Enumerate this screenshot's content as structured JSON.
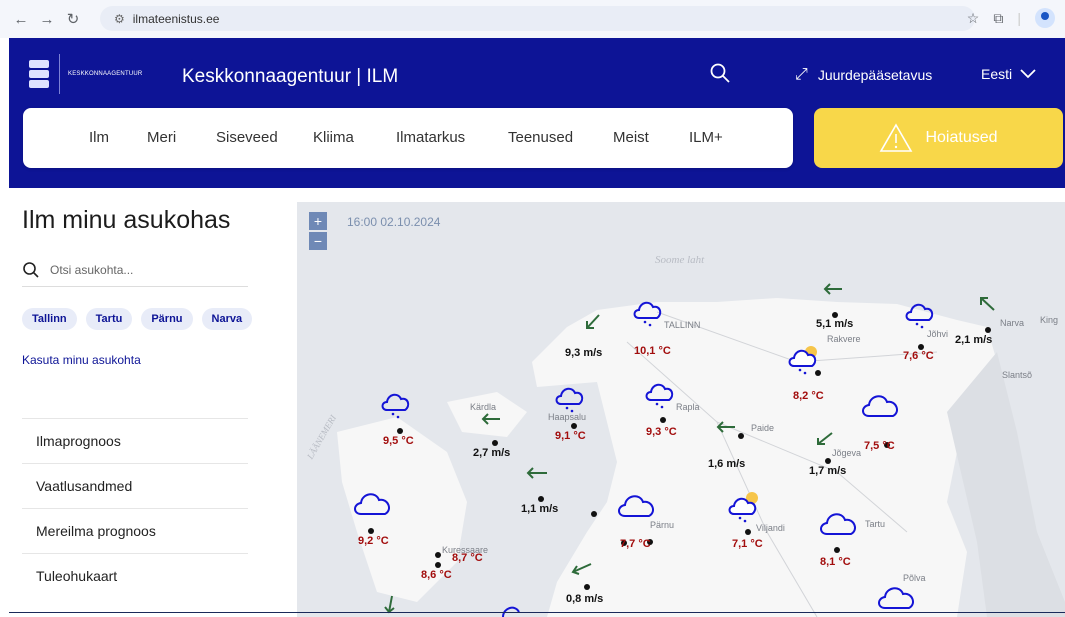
{
  "browser": {
    "url": "ilmateenistus.ee"
  },
  "header": {
    "logo_text": "KESKKONNAAGENTUUR",
    "title": "Keskkonnaagentuur | ILM",
    "access_label": "Juurdepääsetavus",
    "lang_label": "Eesti"
  },
  "menu": [
    "Ilm",
    "Meri",
    "Siseveed",
    "Kliima",
    "Ilmatarkus",
    "Teenused",
    "Meist",
    "ILM+"
  ],
  "warning_button": "Hoiatused",
  "left": {
    "title": "Ilm minu asukohas",
    "search_placeholder": "Otsi asukohta...",
    "cities": [
      "Tallinn",
      "Tartu",
      "Pärnu",
      "Narva"
    ],
    "use_location": "Kasuta minu asukohta",
    "nav": [
      "Ilmaprognoos",
      "Vaatlusandmed",
      "Mereilma prognoos",
      "Tuleohukaart"
    ]
  },
  "map": {
    "timestamp": "16:00 02.10.2024",
    "zoom_in": "+",
    "zoom_out": "−",
    "sea_labels": [
      "Soome laht",
      "LÄÄNEMERI"
    ],
    "places": [
      "TALLINN",
      "Rakvere",
      "Jõhvi",
      "Narva",
      "King",
      "Slantsõ",
      "Kärdla",
      "Haapsalu",
      "Rapla",
      "Paide",
      "Jõgeva",
      "Tartu",
      "Pärnu",
      "Viljandi",
      "Kuressaare",
      "Põlva"
    ],
    "temperatures": [
      "10,1 °C",
      "7,6 °C",
      "8,2 °C",
      "9,5 °C",
      "9,1 °C",
      "9,3 °C",
      "7,5 °C",
      "9,2 °C",
      "8,7 °C",
      "8,6 °C",
      "7,7 °C",
      "7,1 °C",
      "8,1 °C"
    ],
    "winds": [
      "9,3 m/s",
      "5,1 m/s",
      "2,1 m/s",
      "2,7 m/s",
      "1,6 m/s",
      "1,7 m/s",
      "1,1 m/s",
      "0,8 m/s"
    ]
  }
}
